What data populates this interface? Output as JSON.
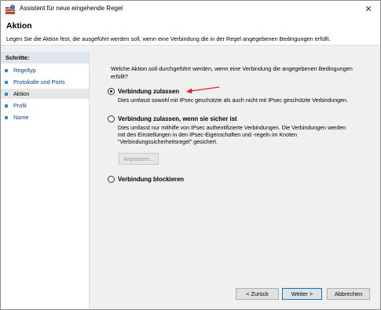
{
  "window": {
    "title": "Assistent für neue eingehende Regel",
    "close_glyph": "✕"
  },
  "header": {
    "title": "Aktion",
    "description": "Legen Sie die Aktion fest, die ausgeführt werden soll, wenn eine Verbindung die in der Regel angegebenen Bedingungen erfüllt."
  },
  "steps": {
    "title": "Schritte:",
    "items": [
      {
        "label": "Regeltyp"
      },
      {
        "label": "Protokolle und Ports"
      },
      {
        "label": "Aktion"
      },
      {
        "label": "Profil"
      },
      {
        "label": "Name"
      }
    ]
  },
  "content": {
    "question_line1": "Welche Aktion soll durchgeführt werden, wenn eine Verbindung die angegebenen Bedingungen",
    "question_line2": "erfüllt?",
    "options": [
      {
        "label": "Verbindung zulassen",
        "desc1": "Dies umfasst sowohl mit IPsec geschützte als auch nicht mit IPsec geschützte Verbindungen.",
        "selected": true
      },
      {
        "label": "Verbindung zulassen, wenn sie sicher ist",
        "desc1": "Dies umfasst nur mithilfe von IPsec authentifizierte Verbindungen. Die Verbindungen werden",
        "desc2": "mit den Einstellungen in den IPsec-Eigenschaften und -regeln im Knoten",
        "desc3": "\"Verbindungssicherheitsregel\" gesichert.",
        "selected": false
      },
      {
        "label": "Verbindung blockieren",
        "selected": false
      }
    ],
    "customize_button": "Anpassen..."
  },
  "footer": {
    "back": "< Zurück",
    "next": "Weiter >",
    "cancel": "Abbrechen"
  },
  "colors": {
    "annotation_arrow": "#e02020",
    "link": "#0b3c96",
    "accent": "#0078d7"
  }
}
